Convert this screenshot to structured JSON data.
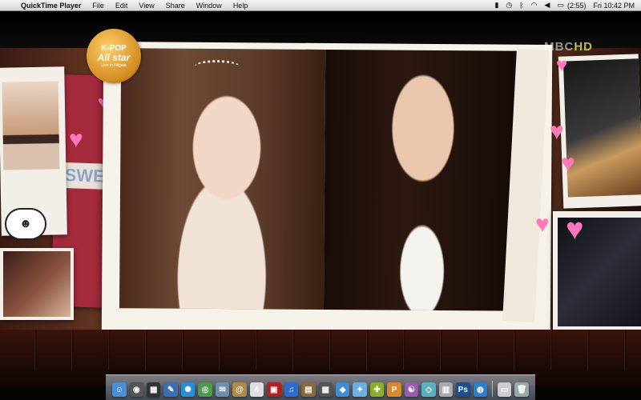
{
  "menubar": {
    "app_name": "QuickTime Player",
    "items": [
      "File",
      "Edit",
      "View",
      "Share",
      "Window",
      "Help"
    ],
    "battery": "(2:55)",
    "clock": "Fri 10:42 PM"
  },
  "video": {
    "logo": {
      "line1": "K-POP",
      "line2": "All star",
      "line3": "Live in Niigata"
    },
    "channel": {
      "name": "MBC",
      "suffix": "HD"
    },
    "banner_text": "SWE"
  },
  "dock": {
    "icons": [
      {
        "name": "finder-icon",
        "color": "#4a90d9",
        "glyph": "☺"
      },
      {
        "name": "dashboard-icon",
        "color": "#555",
        "glyph": "◉"
      },
      {
        "name": "mission-control-icon",
        "color": "#333",
        "glyph": "▦"
      },
      {
        "name": "preview-icon",
        "color": "#3d6fb0",
        "glyph": "✎"
      },
      {
        "name": "safari-icon",
        "color": "#2a8fd8",
        "glyph": "✺"
      },
      {
        "name": "facetime-icon",
        "color": "#4c9a4c",
        "glyph": "◎"
      },
      {
        "name": "mail-icon",
        "color": "#6a8fb0",
        "glyph": "✉"
      },
      {
        "name": "address-book-icon",
        "color": "#b08a4a",
        "glyph": "@"
      },
      {
        "name": "ical-icon",
        "color": "#ddd",
        "glyph": "4"
      },
      {
        "name": "photo-booth-icon",
        "color": "#b02020",
        "glyph": "▣"
      },
      {
        "name": "itunes-icon",
        "color": "#2a6fcf",
        "glyph": "♫"
      },
      {
        "name": "iphoto-icon",
        "color": "#8a6a3a",
        "glyph": "▤"
      },
      {
        "name": "app-store-icon",
        "color": "#555",
        "glyph": "▩"
      },
      {
        "name": "messenger-icon",
        "color": "#3a8fd8",
        "glyph": "◆"
      },
      {
        "name": "msn-icon",
        "color": "#6ab0e0",
        "glyph": "✦"
      },
      {
        "name": "skype-icon",
        "color": "#8ab02a",
        "glyph": "✚"
      },
      {
        "name": "cyberduck-icon",
        "color": "#d88a2a",
        "glyph": "P"
      },
      {
        "name": "dreamweaver-icon",
        "color": "#9a5ab0",
        "glyph": "☯"
      },
      {
        "name": "utility-icon",
        "color": "#5ab0c0",
        "glyph": "◇"
      },
      {
        "name": "automator-icon",
        "color": "#aaa",
        "glyph": "▥"
      },
      {
        "name": "photoshop-icon",
        "color": "#1d4f8a",
        "glyph": "Ps"
      },
      {
        "name": "network-icon",
        "color": "#2a7fd0",
        "glyph": "◍"
      },
      {
        "name": "documents-icon",
        "color": "#ccc",
        "glyph": "▭"
      },
      {
        "name": "trash-icon",
        "color": "#9aa",
        "glyph": "🗑"
      }
    ]
  }
}
